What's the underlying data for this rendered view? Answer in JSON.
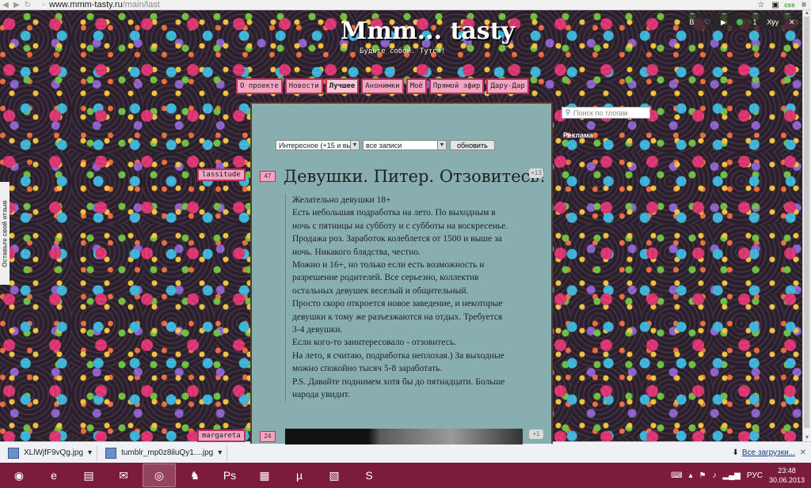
{
  "browser": {
    "url_host": "www.mmm-tasty.ru",
    "url_path": "/main/last",
    "ext_label": "css"
  },
  "social": {
    "user": "Xyy",
    "items": [
      "B",
      "♡",
      "▶",
      "1",
      "Xyy",
      "✕"
    ]
  },
  "site": {
    "logo": "Mmm... tasty",
    "tagline": "Будьте собой. Тутся!"
  },
  "nav": [
    {
      "label": "О проекте"
    },
    {
      "label": "Новости"
    },
    {
      "label": "Лучшее"
    },
    {
      "label": "Анонимки"
    },
    {
      "label": "Моё"
    },
    {
      "label": "Прямой эфир"
    },
    {
      "label": "Дару-Дар"
    }
  ],
  "sidebar": {
    "search_placeholder": "Поиск по тлогам",
    "ad_label": "Реклама"
  },
  "feedback_label": "Оставьте свой отзыв",
  "filters": {
    "type_value": "Интересное (+15 и вы",
    "records_value": "все записи",
    "refresh_label": "обновить"
  },
  "posts": [
    {
      "author": "lassitude",
      "rating": "47",
      "comments": "+13",
      "title": "Девушки. Питер. Отзовитесь!",
      "lines": [
        "Желательно девушки 18+",
        "Есть небольшая подработка на лето. По выходным в",
        "ночь с пятницы на субботу и с субботы на воскресенье.",
        "Продажа роз. Заработок колеблется от 1500 и выше за",
        "ночь. Никакого блядства, честно.",
        "Можно и 16+, но только если есть возможность и",
        "разрешение родителей. Все серьезно, коллектив",
        "остальных девушек веселый и общительный.",
        "Просто скоро откроется новое заведение, и некоторые",
        "девушки к тому же разъезжаются на отдых. Требуется",
        "3-4 девушки.",
        "Если кого-то заинтересовало - отзовитесь.",
        "На лето, я считаю, подработка неплохая.) За выходные",
        "можно спокойно тысяч 5-8 заработать.",
        "P.S. Давайте поднимем хотя бы до пятнадцати. Больше",
        "народа увидит."
      ]
    },
    {
      "author": "margareta",
      "rating": "24",
      "comments": "+1"
    }
  ],
  "downloads": {
    "items": [
      "XLlWjfF9vQg.jpg",
      "tumblr_mp0z8iluQy1....jpg"
    ],
    "all_label": "Все загрузки..."
  },
  "taskbar": {
    "lang": "РУС",
    "time": "23:48",
    "date": "30.06.2013"
  }
}
